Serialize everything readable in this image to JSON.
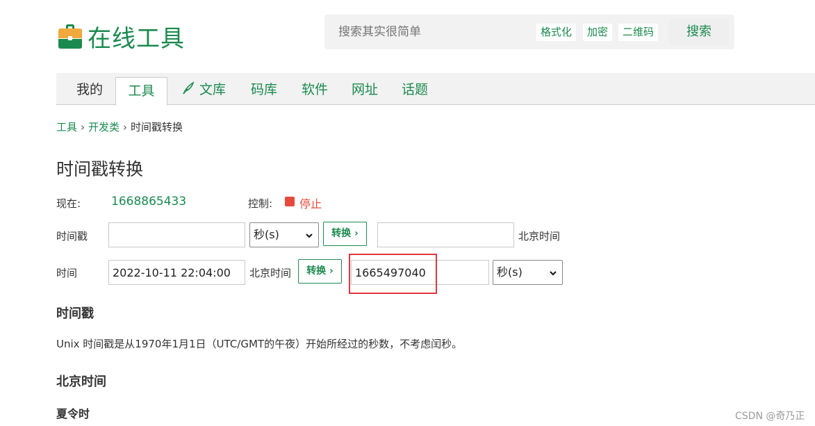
{
  "header": {
    "logo_text": "在线工具",
    "search_placeholder": "搜索其实很简单",
    "chips": [
      "格式化",
      "加密",
      "二维码"
    ],
    "search_button": "搜索"
  },
  "nav": {
    "items": [
      {
        "label": "我的"
      },
      {
        "label": "工具",
        "active": true
      },
      {
        "label": "文库"
      },
      {
        "label": "码库"
      },
      {
        "label": "软件"
      },
      {
        "label": "网址"
      },
      {
        "label": "话题"
      }
    ]
  },
  "breadcrumb": {
    "items": [
      "工具",
      "开发类",
      "时间戳转换"
    ],
    "separator": "›"
  },
  "page_title": "时间戳转换",
  "now": {
    "label": "现在:",
    "value": "1668865433",
    "control_label": "控制:",
    "stop_label": "停止"
  },
  "row_timestamp": {
    "label": "时间戳",
    "input_value": "",
    "unit_selected": "秒(s)",
    "convert_button": "转换 ›",
    "output_value": "",
    "output_suffix": "北京时间"
  },
  "row_time": {
    "label": "时间",
    "input_value": "2022-10-11 22:04:00",
    "input_suffix": "北京时间",
    "convert_button": "转换 ›",
    "output_value": "1665497040",
    "unit_selected": "秒(s)"
  },
  "sections": {
    "timestamp_heading": "时间戳",
    "timestamp_desc": "Unix 时间戳是从1970年1月1日（UTC/GMT的午夜）开始所经过的秒数，不考虑闰秒。",
    "beijing_heading": "北京时间",
    "dst_heading": "夏令时"
  },
  "watermark": "CSDN @奇乃正",
  "colors": {
    "brand": "#1b8a4f",
    "stop": "#e64a3c",
    "highlight": "#e0363f"
  }
}
